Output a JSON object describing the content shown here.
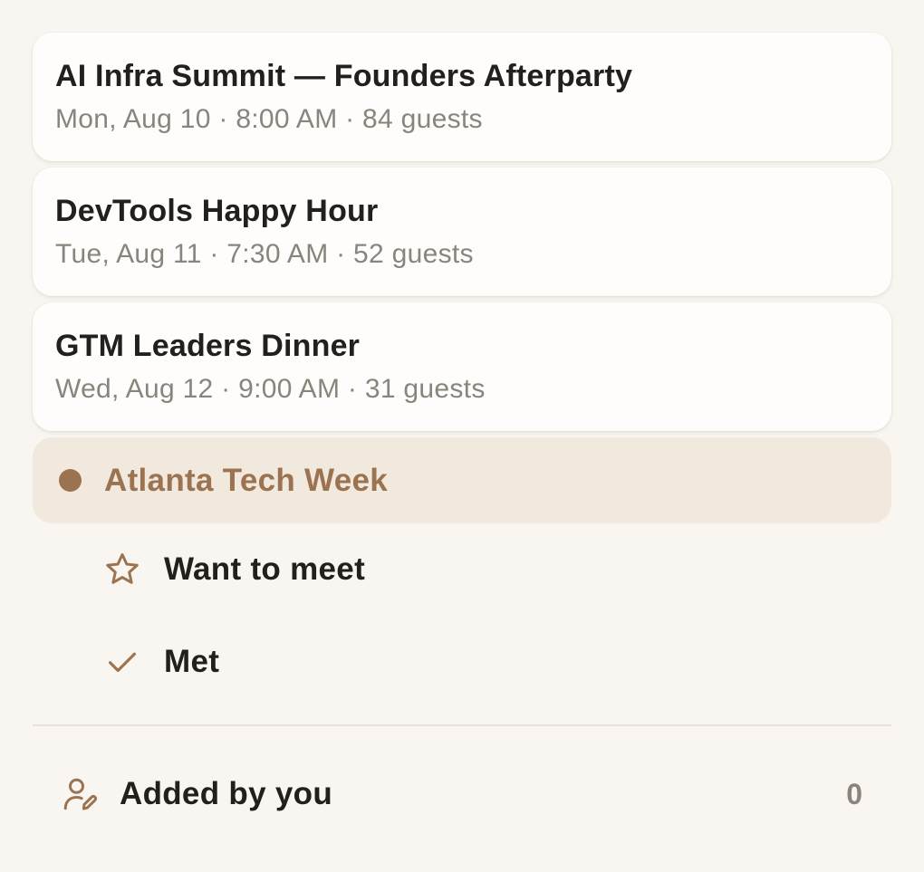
{
  "events": [
    {
      "title": "AI Infra Summit — Founders Afterparty",
      "meta": "Mon, Aug 10 · 8:00 AM · 84 guests"
    },
    {
      "title": "DevTools Happy Hour",
      "meta": "Tue, Aug 11 · 7:30 AM · 52 guests"
    },
    {
      "title": "GTM Leaders Dinner",
      "meta": "Wed, Aug 12 · 9:00 AM · 31 guests"
    }
  ],
  "group": {
    "label": "Atlanta Tech Week",
    "icon": "dot-icon",
    "selected": true
  },
  "sub_items": [
    {
      "label": "Want to meet",
      "icon": "star-icon"
    },
    {
      "label": "Met",
      "icon": "check-icon"
    }
  ],
  "footer": {
    "label": "Added by you",
    "icon": "user-edit-icon",
    "count": "0"
  },
  "colors": {
    "background": "#f9f6f1",
    "card": "#fefdfb",
    "accent": "#9c7350",
    "selected_bg": "#f1e8de",
    "muted_text": "#8a857c",
    "text": "#22201c"
  }
}
